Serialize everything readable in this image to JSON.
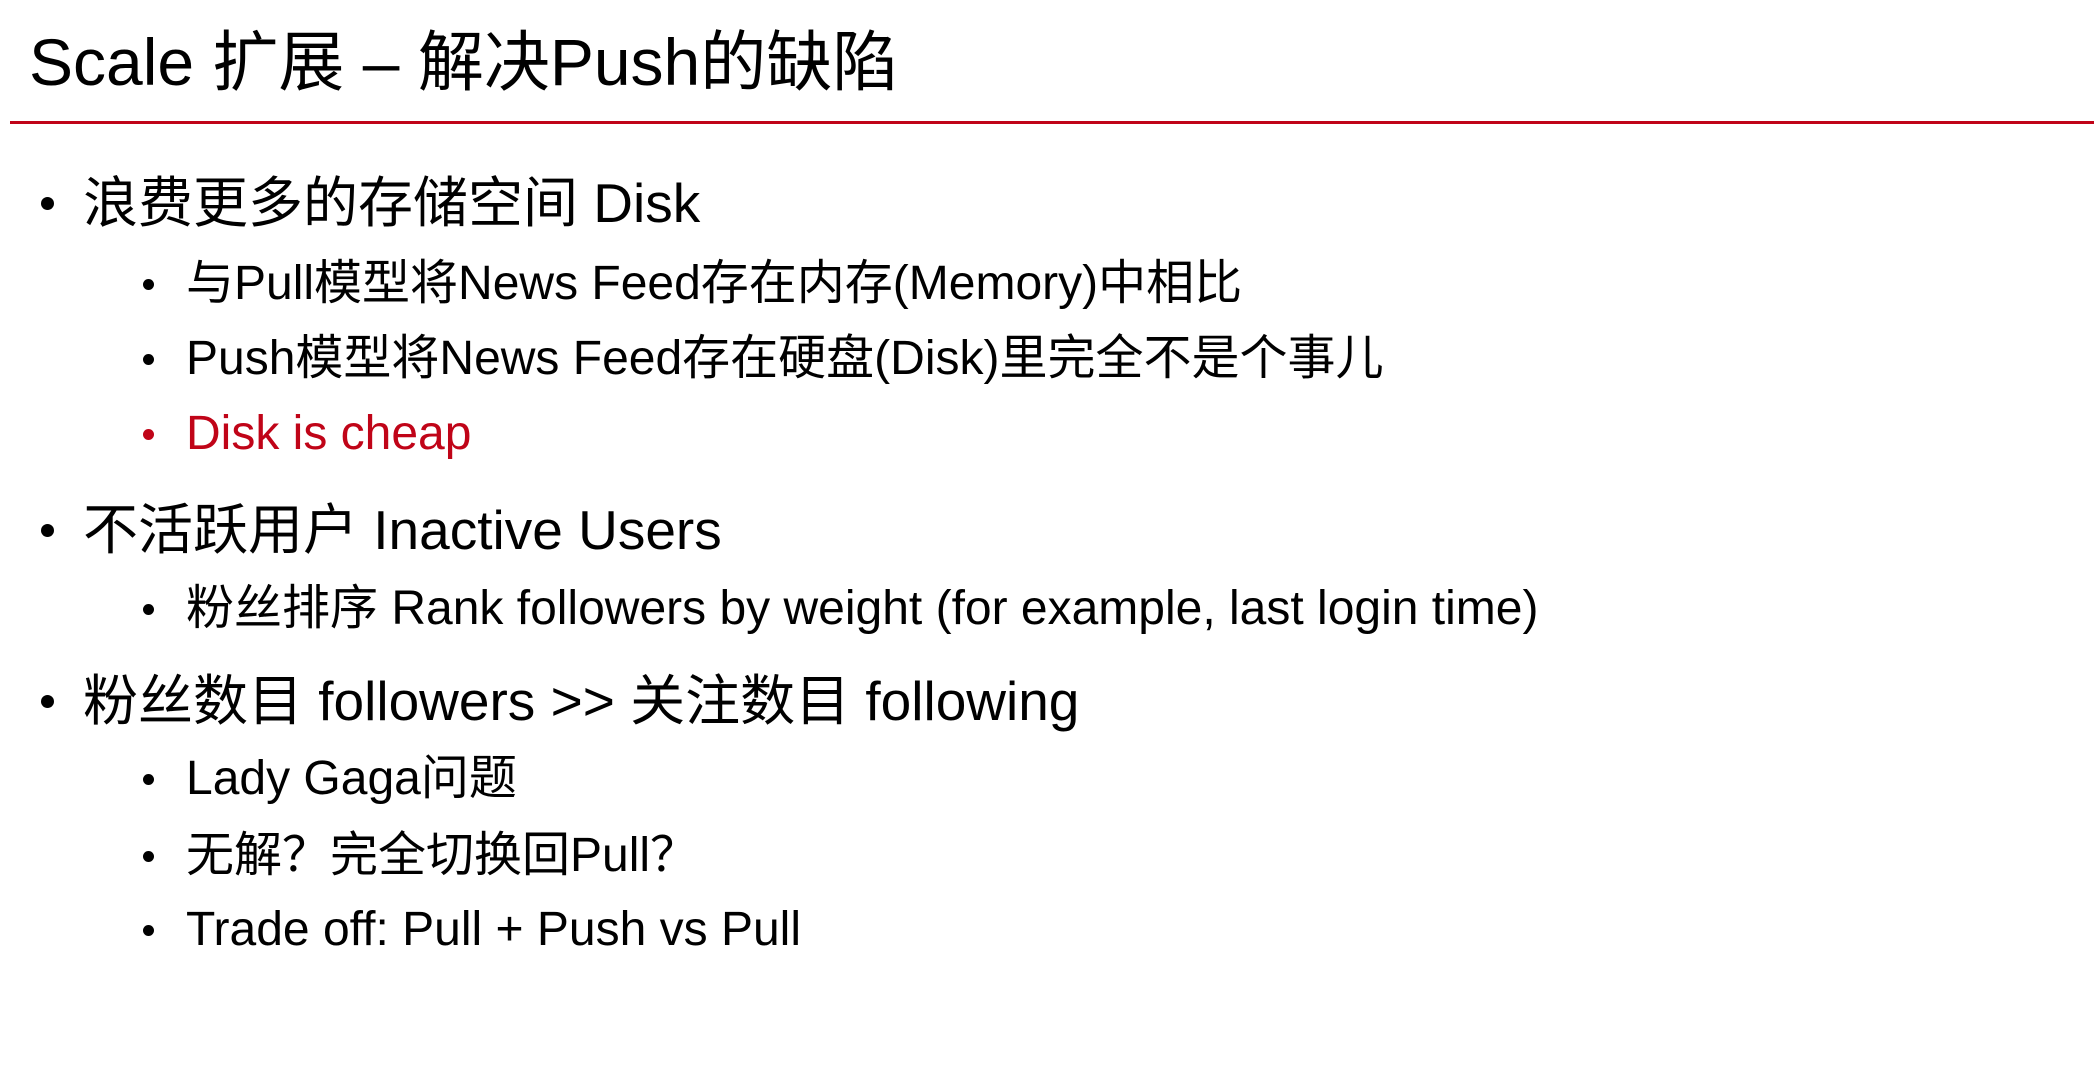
{
  "slide": {
    "title": "Scale 扩展 – 解决Push的缺陷",
    "accent_color": "#C00418",
    "sections": [
      {
        "label": "浪费更多的存储空间 Disk",
        "items": [
          {
            "label": "与Pull模型将News Feed存在内存(Memory)中相比"
          },
          {
            "label": "Push模型将News Feed存在硬盘(Disk)里完全不是个事儿"
          },
          {
            "label": "Disk is cheap",
            "highlight": true
          }
        ]
      },
      {
        "label": "不活跃用户 Inactive Users",
        "items": [
          {
            "label": "粉丝排序 Rank followers by weight (for example, last login time)"
          }
        ]
      },
      {
        "label": "粉丝数目 followers >> 关注数目 following",
        "items": [
          {
            "label": "Lady Gaga问题"
          },
          {
            "label": "无解？完全切换回Pull？"
          },
          {
            "label": "Trade off: Pull + Push vs Pull"
          }
        ]
      }
    ]
  }
}
